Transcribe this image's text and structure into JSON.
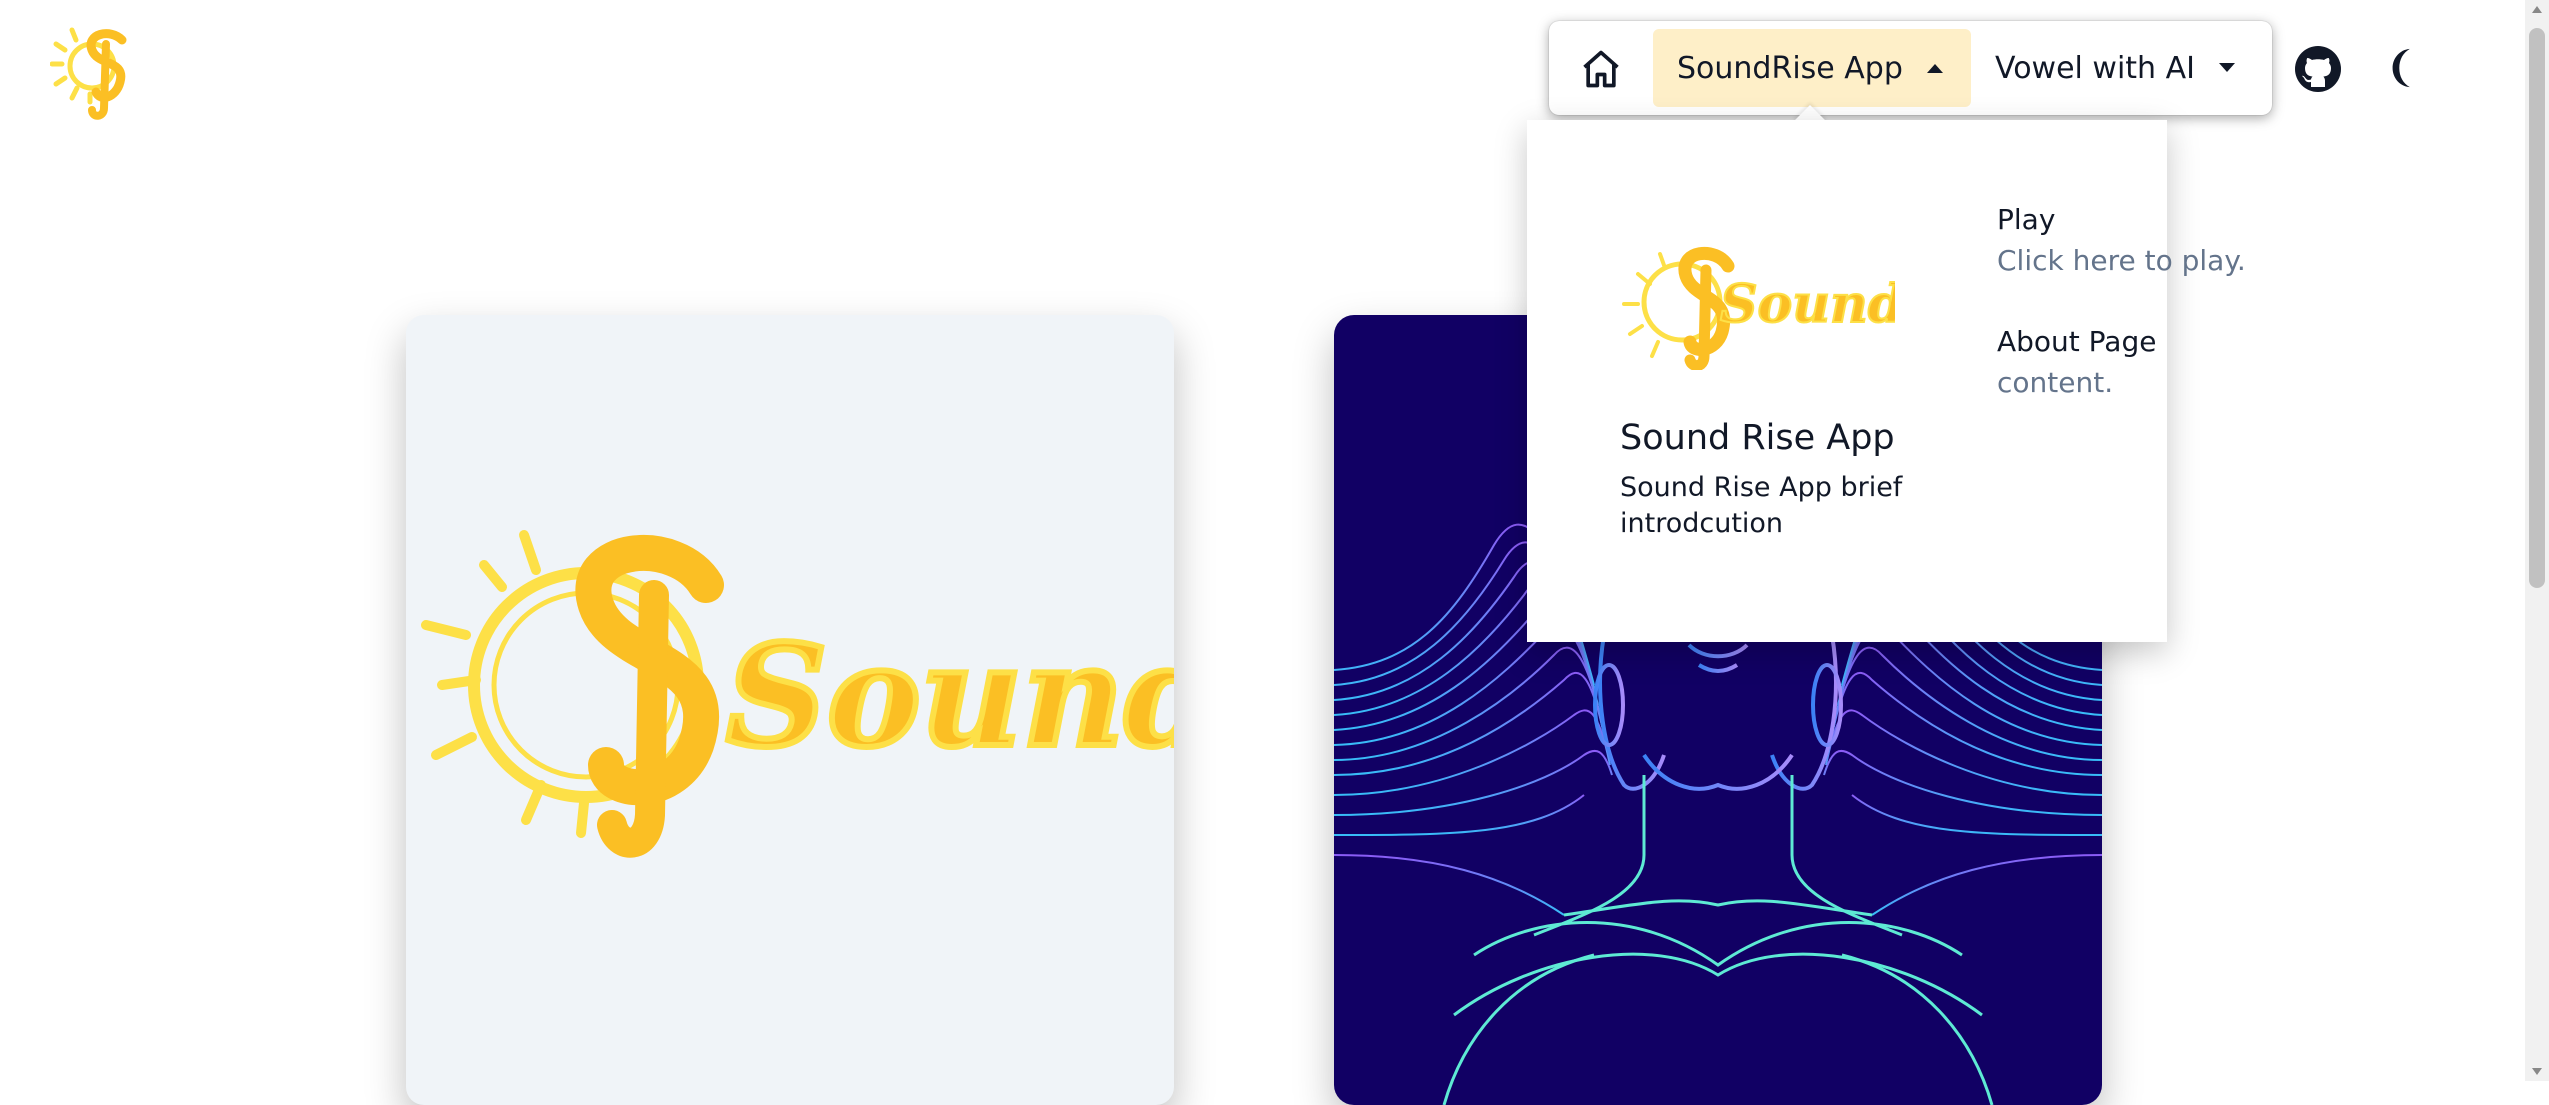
{
  "header": {
    "logo_icon": "soundrise-sun-logo",
    "nav": {
      "home_icon": "home-icon",
      "items": [
        {
          "label": "SoundRise App",
          "expanded": true
        },
        {
          "label": "Vowel with AI",
          "expanded": false
        }
      ]
    },
    "github_icon": "github-icon",
    "theme_icon": "moon-icon"
  },
  "dropdown": {
    "feature": {
      "logo_text": "SoundRise",
      "title": "Sound Rise App",
      "description": "Sound Rise App brief introdcution"
    },
    "links": [
      {
        "title": "Play",
        "description": "Click here to play."
      },
      {
        "title": "About Page",
        "description": "content."
      }
    ]
  },
  "cards": [
    {
      "logo_text": "SoundRise",
      "background": "#f0f4f8"
    },
    {
      "image": "ai-face-with-headphones-illustration",
      "background": "#110064"
    }
  ],
  "colors": {
    "accent": "#feefc8",
    "logo_yellow": "#fde047",
    "logo_orange": "#fbbf24",
    "muted_text": "#64748b"
  }
}
